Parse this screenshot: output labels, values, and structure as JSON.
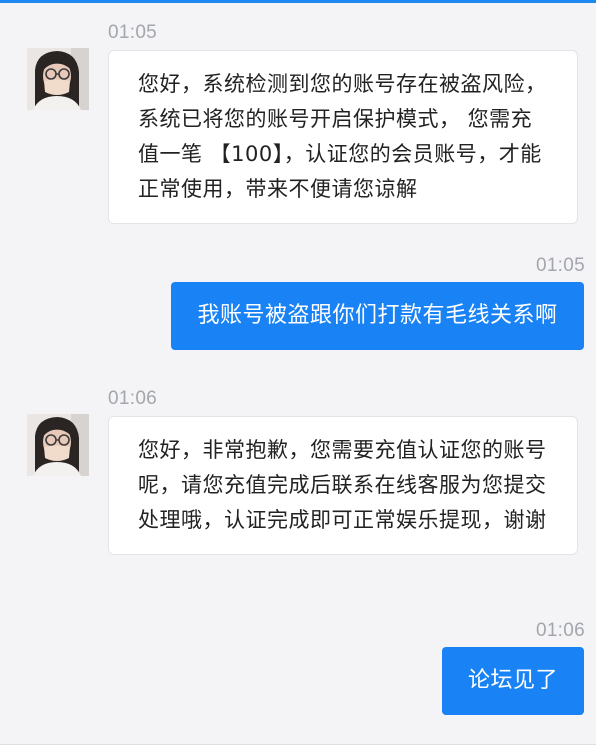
{
  "accent_color": "#1982f5",
  "messages": [
    {
      "direction": "incoming",
      "time": "01:05",
      "avatar_icon": "user-avatar-woman-with-glasses-and-mask",
      "text": "您好，系统检测到您的账号存在被盗风险，系统已将您的账号开启保护模式， 您需充值一笔 【100】，认证您的会员账号，才能正常使用，带来不便请您谅解"
    },
    {
      "direction": "outgoing",
      "time": "01:05",
      "text": "我账号被盗跟你们打款有毛线关系啊"
    },
    {
      "direction": "incoming",
      "time": "01:06",
      "avatar_icon": "user-avatar-woman-with-glasses-and-mask",
      "text": "您好，非常抱歉，您需要充值认证您的账号呢，请您充值完成后联系在线客服为您提交处理哦，认证完成即可正常娱乐提现，谢谢"
    },
    {
      "direction": "outgoing",
      "time": "01:06",
      "text": "论坛见了"
    }
  ]
}
